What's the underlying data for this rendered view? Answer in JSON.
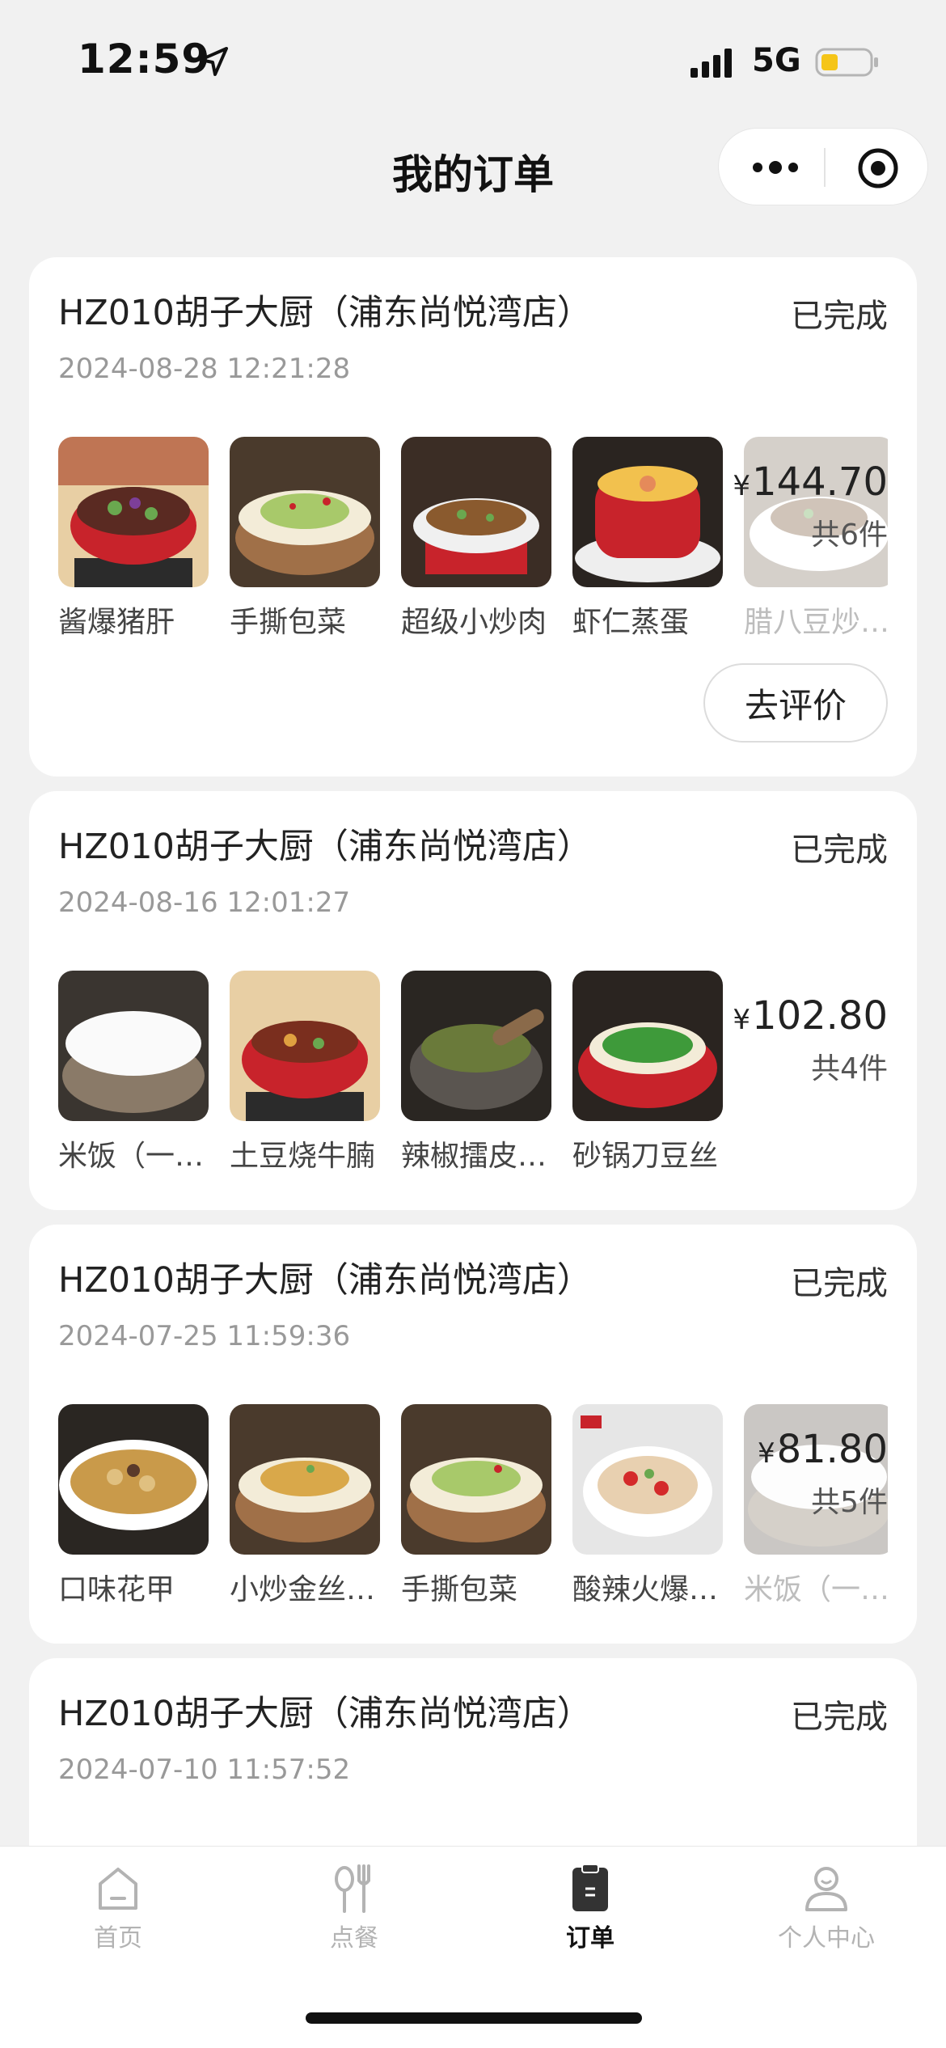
{
  "status_bar": {
    "time": "12:59",
    "network": "5G"
  },
  "header": {
    "title": "我的订单"
  },
  "orders": [
    {
      "store": "HZ010胡子大厨（浦东尚悦湾店）",
      "status": "已完成",
      "datetime": "2024-08-28 12:21:28",
      "items": [
        "酱爆猪肝",
        "手撕包菜",
        "超级小炒肉",
        "虾仁蒸蛋",
        "腊八豆炒…"
      ],
      "price": "144.70",
      "currency": "¥",
      "count": "共6件",
      "action": "去评价"
    },
    {
      "store": "HZ010胡子大厨（浦东尚悦湾店）",
      "status": "已完成",
      "datetime": "2024-08-16 12:01:27",
      "items": [
        "米饭（一…",
        "土豆烧牛腩",
        "辣椒擂皮…",
        "砂锅刀豆丝"
      ],
      "price": "102.80",
      "currency": "¥",
      "count": "共4件"
    },
    {
      "store": "HZ010胡子大厨（浦东尚悦湾店）",
      "status": "已完成",
      "datetime": "2024-07-25 11:59:36",
      "items": [
        "口味花甲",
        "小炒金丝…",
        "手撕包菜",
        "酸辣火爆…",
        "米饭（一…"
      ],
      "price": "81.80",
      "currency": "¥",
      "count": "共5件"
    },
    {
      "store": "HZ010胡子大厨（浦东尚悦湾店）",
      "status": "已完成",
      "datetime": "2024-07-10 11:57:52"
    }
  ],
  "tabbar": {
    "items": [
      {
        "label": "首页",
        "icon": "home-icon"
      },
      {
        "label": "点餐",
        "icon": "cutlery-icon"
      },
      {
        "label": "订单",
        "icon": "order-clipboard-icon"
      },
      {
        "label": "个人中心",
        "icon": "profile-icon"
      }
    ],
    "active": "订单"
  },
  "colors": {
    "background": "#f1f1f1",
    "card": "#ffffff",
    "bowl_red": "#c8232b",
    "muted_text": "#999999"
  }
}
